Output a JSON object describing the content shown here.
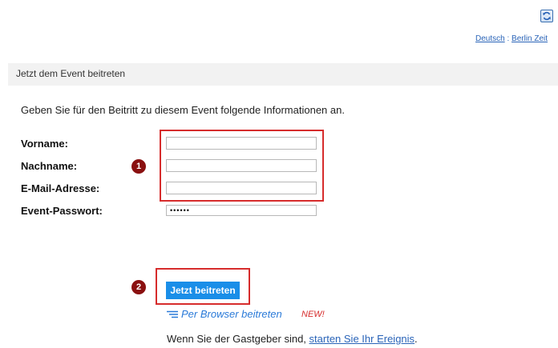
{
  "toolbar": {
    "refresh_icon": "refresh-icon",
    "locale": {
      "language": "Deutsch",
      "separator": " : ",
      "timezone": "Berlin Zeit"
    }
  },
  "header": {
    "title": "Jetzt dem Event beitreten"
  },
  "form": {
    "intro": "Geben Sie für den Beitritt zu diesem Event folgende Informationen an.",
    "fields": [
      {
        "label": "Vorname:",
        "value": ""
      },
      {
        "label": "Nachname:",
        "value": ""
      },
      {
        "label": "E-Mail-Adresse:",
        "value": ""
      },
      {
        "label": "Event-Passwort:",
        "value": "••••••"
      }
    ],
    "join_button": "Jetzt beitreten",
    "browser_join": "Per Browser beitreten",
    "new_badge": "NEW!",
    "host_prefix": "Wenn Sie der Gastgeber sind, ",
    "host_link": "starten Sie Ihr Ereignis",
    "host_suffix": "."
  },
  "callouts": {
    "step1": "1",
    "step2": "2"
  },
  "colors": {
    "accent": "#1a8ee8",
    "callout_border": "#d62c2c",
    "badge_bg": "#8a1010",
    "link": "#2a64b8"
  }
}
